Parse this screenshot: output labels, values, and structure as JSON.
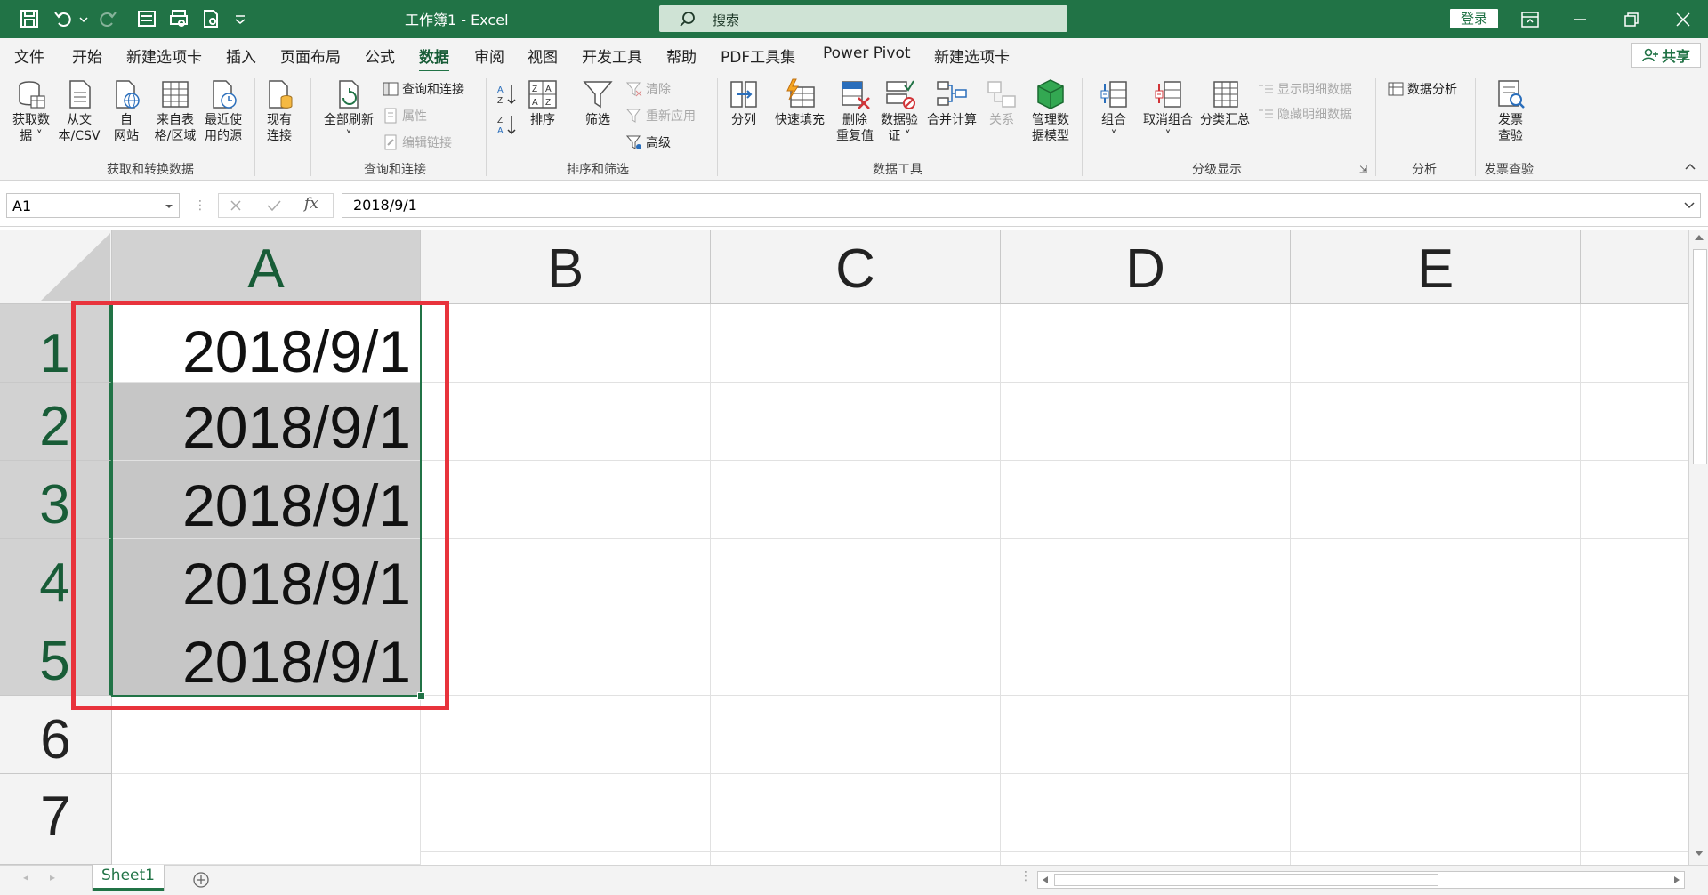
{
  "titlebar": {
    "title": "工作簿1 - Excel",
    "search_placeholder": "搜索",
    "login": "登录"
  },
  "tabs": [
    "文件",
    "开始",
    "新建选项卡",
    "插入",
    "页面布局",
    "公式",
    "数据",
    "审阅",
    "视图",
    "开发工具",
    "帮助",
    "PDF工具集",
    "Power Pivot",
    "新建选项卡"
  ],
  "active_tab": "数据",
  "share": "共享",
  "ribbon": {
    "get_data": [
      "获取数",
      "据"
    ],
    "from_csv": [
      "从文",
      "本/CSV"
    ],
    "from_web": [
      "自",
      "网站"
    ],
    "from_table": [
      "来自表",
      "格/区域"
    ],
    "recent_sources": [
      "最近使",
      "用的源"
    ],
    "existing_conn": [
      "现有",
      "连接"
    ],
    "group_get": "获取和转换数据",
    "refresh_all": [
      "全部刷新"
    ],
    "queries_conn": "查询和连接",
    "properties": "属性",
    "edit_links": "编辑链接",
    "group_queries": "查询和连接",
    "sort": "排序",
    "filter": "筛选",
    "clear": "清除",
    "reapply": "重新应用",
    "advanced": "高级",
    "group_sort": "排序和筛选",
    "text_to_columns": "分列",
    "flash_fill": "快速填充",
    "remove_dup": [
      "删除",
      "重复值"
    ],
    "data_validation": [
      "数据验",
      "证"
    ],
    "consolidate": "合并计算",
    "relationships": "关系",
    "data_model": [
      "管理数",
      "据模型"
    ],
    "group_tools": "数据工具",
    "group_btn": "组合",
    "ungroup": "取消组合",
    "subtotal": "分类汇总",
    "show_detail": "显示明细数据",
    "hide_detail": "隐藏明细数据",
    "group_outline": "分级显示",
    "data_analysis": "数据分析",
    "group_analysis": "分析",
    "invoice": [
      "发票",
      "查验"
    ],
    "group_invoice": "发票查验"
  },
  "formula_bar": {
    "name_box": "A1",
    "fx": "fx",
    "value": "2018/9/1"
  },
  "columns": [
    "A",
    "B",
    "C",
    "D",
    "E"
  ],
  "rows": [
    "1",
    "2",
    "3",
    "4",
    "5",
    "6",
    "7"
  ],
  "cells": {
    "A1": "2018/9/1",
    "A2": "2018/9/1",
    "A3": "2018/9/1",
    "A4": "2018/9/1",
    "A5": "2018/9/1"
  },
  "sheet_tab": "Sheet1",
  "colors": {
    "accent": "#217346",
    "highlight_box": "#e8333c",
    "selection_fill": "#c6c6c6"
  }
}
